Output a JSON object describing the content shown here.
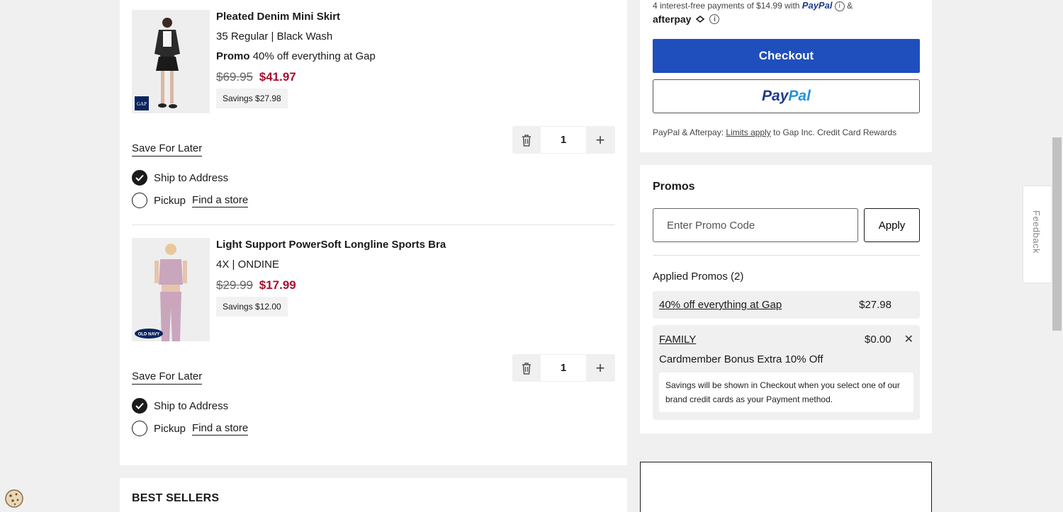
{
  "cart": {
    "items": [
      {
        "title": "Pleated Denim Mini Skirt",
        "variant": "35 Regular | Black Wash",
        "promo_label": "Promo",
        "promo_text": "40% off everything at Gap",
        "old_price": "$69.95",
        "new_price": "$41.97",
        "savings": "Savings $27.98",
        "brand_badge": "GAP",
        "save_for_later": "Save For Later",
        "quantity": "1",
        "ship_label": "Ship to Address",
        "pickup_label": "Pickup",
        "find_store": "Find a store"
      },
      {
        "title": "Light Support PowerSoft Longline Sports Bra",
        "variant": "4X | ONDINE",
        "old_price": "$29.99",
        "new_price": "$17.99",
        "savings": "Savings $12.00",
        "brand_badge": "OLD NAVY",
        "save_for_later": "Save For Later",
        "quantity": "1",
        "ship_label": "Ship to Address",
        "pickup_label": "Pickup",
        "find_store": "Find a store"
      }
    ],
    "best_sellers_label": "BEST SELLERS"
  },
  "checkout": {
    "installments_text": "4 interest-free payments of $14.99 with",
    "paypal_word": "PayPal",
    "ampersand": "&",
    "afterpay_word": "afterpay",
    "checkout_label": "Checkout",
    "paypal_pay": "Pay",
    "paypal_pal": "Pal",
    "rewards_prefix": "PayPal & Afterpay:",
    "rewards_link": "Limits apply",
    "rewards_suffix": "to Gap Inc. Credit Card Rewards"
  },
  "promos": {
    "title": "Promos",
    "input_placeholder": "Enter Promo Code",
    "apply_label": "Apply",
    "applied_title": "Applied Promos (2)",
    "applied": [
      {
        "name": "40% off everything at Gap",
        "amount": "$27.98"
      },
      {
        "name": "FAMILY",
        "amount": "$0.00",
        "description": "Cardmember Bonus Extra 10% Off",
        "note": "Savings will be shown in Checkout when you select one of our brand credit cards as your Payment method."
      }
    ]
  },
  "feedback_label": "Feedback",
  "colors": {
    "checkout_blue": "#1f4fbd",
    "sale_red": "#a8102e",
    "paypal_dark": "#1e3a8a",
    "paypal_light": "#2793d9"
  },
  "icons": [
    "trash-icon",
    "plus-icon",
    "check-icon",
    "info-icon",
    "close-icon",
    "cookie-icon"
  ]
}
